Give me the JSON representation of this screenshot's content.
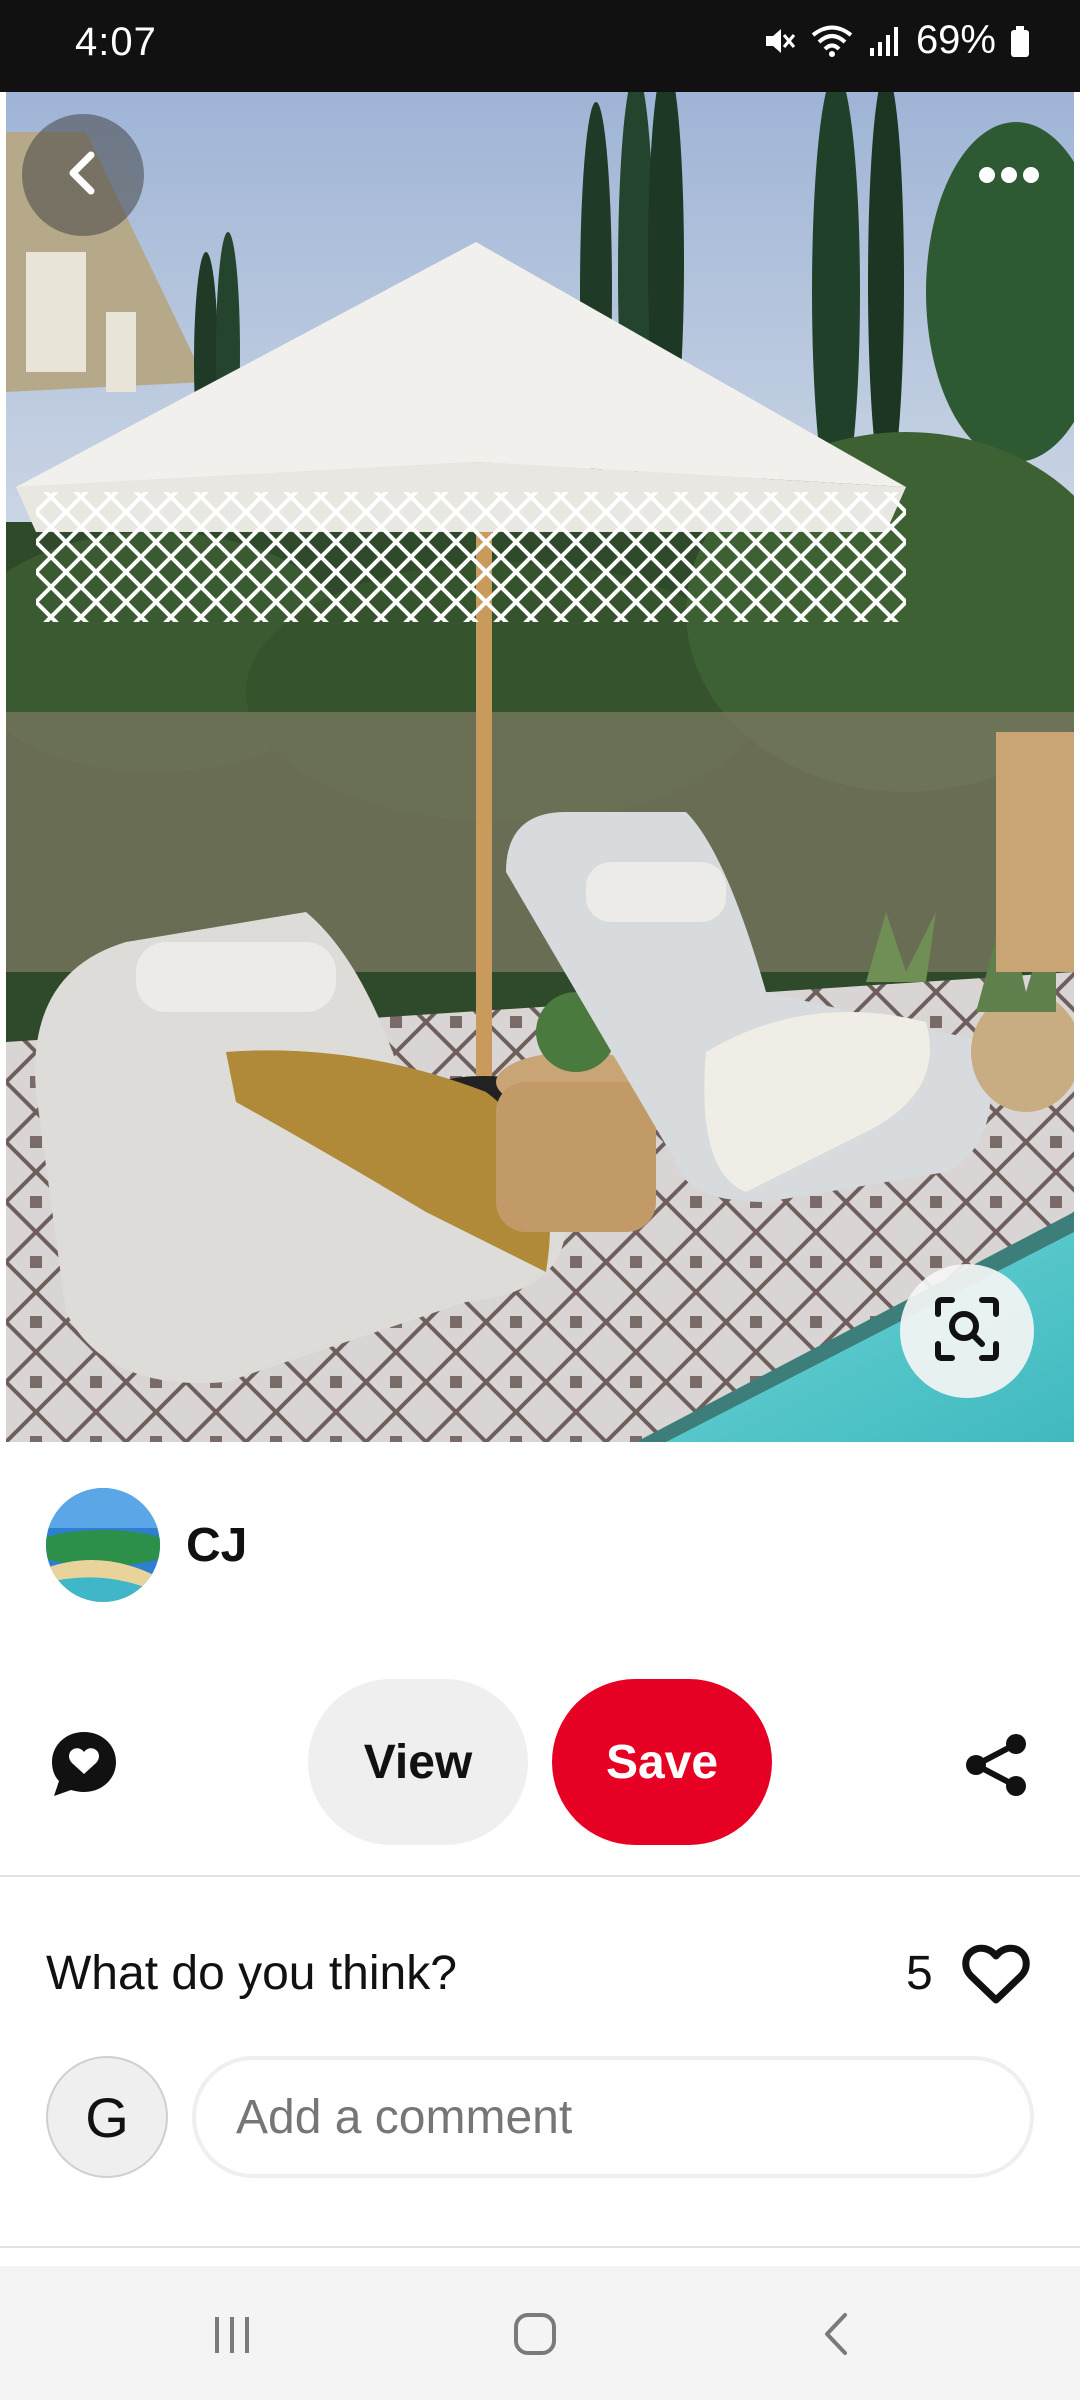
{
  "status_bar": {
    "time": "4:07",
    "battery": "69%",
    "icons": [
      "mute-icon",
      "wifi-icon",
      "signal-icon",
      "battery-icon"
    ]
  },
  "pin": {
    "image_description_icon": "outdoor-patio-photo",
    "top_bar": {
      "back_icon": "chevron-left-icon",
      "more_icon": "more-horizontal-icon"
    },
    "lens_icon": "visual-search-icon"
  },
  "creator": {
    "name": "CJ",
    "avatar_icon": "beach-avatar"
  },
  "actions": {
    "comment_icon": "comment-heart-icon",
    "view_label": "View",
    "save_label": "Save",
    "share_icon": "share-icon",
    "colors": {
      "save": "#e60023",
      "view": "#efefef"
    }
  },
  "comments": {
    "prompt": "What do you think?",
    "like_count": "5",
    "like_icon": "heart-outline-icon",
    "user_initial": "G",
    "input_placeholder": "Add a comment"
  },
  "nav_bar": {
    "icons": [
      "recent-apps-icon",
      "home-icon",
      "back-icon"
    ]
  }
}
